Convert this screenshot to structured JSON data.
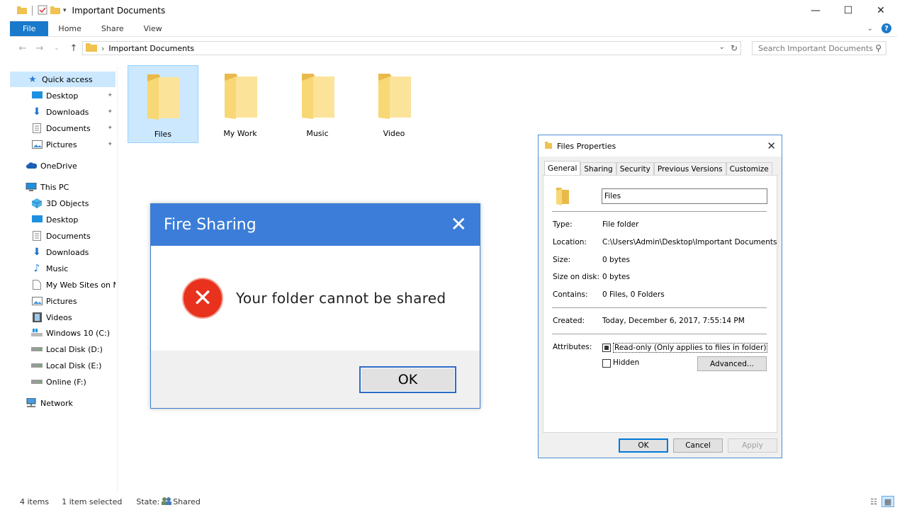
{
  "window": {
    "title": "Important Documents",
    "controls": {
      "minimize": "—",
      "maximize": "☐",
      "close": "✕"
    }
  },
  "ribbon": {
    "tabs": [
      "File",
      "Home",
      "Share",
      "View"
    ],
    "help": "?"
  },
  "address": {
    "path": "Important Documents",
    "search_placeholder": "Search Important Documents"
  },
  "sidebar": {
    "quick_access": "Quick access",
    "quick_items": [
      "Desktop",
      "Downloads",
      "Documents",
      "Pictures"
    ],
    "onedrive": "OneDrive",
    "this_pc": "This PC",
    "pc_items": [
      "3D Objects",
      "Desktop",
      "Documents",
      "Downloads",
      "Music",
      "My Web Sites on M",
      "Pictures",
      "Videos",
      "Windows 10 (C:)",
      "Local Disk (D:)",
      "Local Disk (E:)",
      "Online (F:)"
    ],
    "network": "Network"
  },
  "folders": [
    "Files",
    "My Work",
    "Music",
    "Video"
  ],
  "status": {
    "items": "4 items",
    "selected": "1 item selected",
    "state_label": "State:",
    "state_value": "Shared"
  },
  "error_dialog": {
    "title": "Fire Sharing",
    "message": "Your folder cannot be shared",
    "ok": "OK"
  },
  "properties": {
    "title": "Files Properties",
    "tabs": [
      "General",
      "Sharing",
      "Security",
      "Previous Versions",
      "Customize"
    ],
    "name": "Files",
    "labels": {
      "type": "Type:",
      "location": "Location:",
      "size": "Size:",
      "size_on_disk": "Size on disk:",
      "contains": "Contains:",
      "created": "Created:",
      "attributes": "Attributes:"
    },
    "values": {
      "type": "File folder",
      "location": "C:\\Users\\Admin\\Desktop\\Important Documents",
      "size": "0 bytes",
      "size_on_disk": "0 bytes",
      "contains": "0 Files, 0 Folders",
      "created": "Today, December 6, 2017, 7:55:14 PM"
    },
    "readonly": "Read-only (Only applies to files in folder)",
    "hidden": "Hidden",
    "advanced": "Advanced...",
    "buttons": {
      "ok": "OK",
      "cancel": "Cancel",
      "apply": "Apply"
    }
  },
  "colors": {
    "accent": "#1979ca",
    "selection": "#cce8ff",
    "folder": "#f8d775",
    "error_red": "#e8321e"
  }
}
